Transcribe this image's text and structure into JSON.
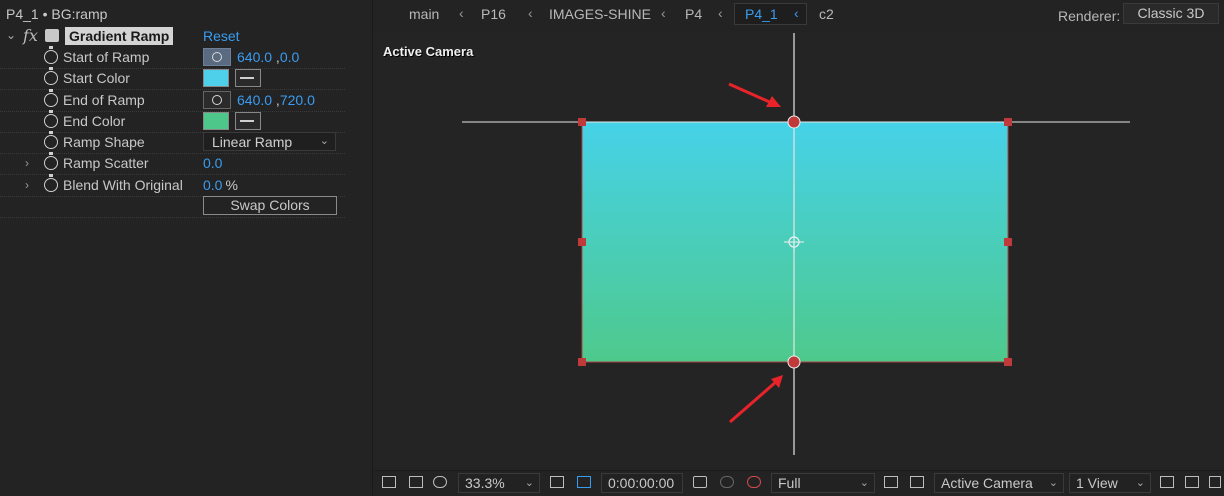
{
  "effect_controls": {
    "title": "P4_1 • BG:ramp",
    "effect_name": "Gradient Ramp",
    "reset_label": "Reset",
    "properties": {
      "start_of_ramp": {
        "label": "Start of Ramp",
        "x": "640.0",
        "y": "0.0"
      },
      "start_color": {
        "label": "Start Color",
        "color": "#4fd0ea"
      },
      "end_of_ramp": {
        "label": "End of Ramp",
        "x": "640.0",
        "y": "720.0"
      },
      "end_color": {
        "label": "End Color",
        "color": "#4ec88a"
      },
      "ramp_shape": {
        "label": "Ramp Shape",
        "value": "Linear Ramp"
      },
      "ramp_scatter": {
        "label": "Ramp Scatter",
        "value": "0.0"
      },
      "blend_with_original": {
        "label": "Blend With Original",
        "value": "0.0",
        "unit": "%"
      },
      "swap_colors_label": "Swap Colors"
    }
  },
  "viewer": {
    "breadcrumbs": [
      "main",
      "P16",
      "IMAGES-SHINE",
      "P4",
      "P4_1",
      "c2"
    ],
    "active_crumb": "P4_1",
    "renderer_label": "Renderer:",
    "renderer_value": "Classic 3D",
    "camera_label": "Active Camera",
    "gradient": {
      "top_color": "#46d2e8",
      "bottom_color": "#4ec98c"
    },
    "annotation_color": "#e8232a"
  },
  "toolbar": {
    "zoom": "33.3%",
    "timecode": "0:00:00:00",
    "resolution": "Full",
    "camera": "Active Camera",
    "views": "1 View"
  }
}
